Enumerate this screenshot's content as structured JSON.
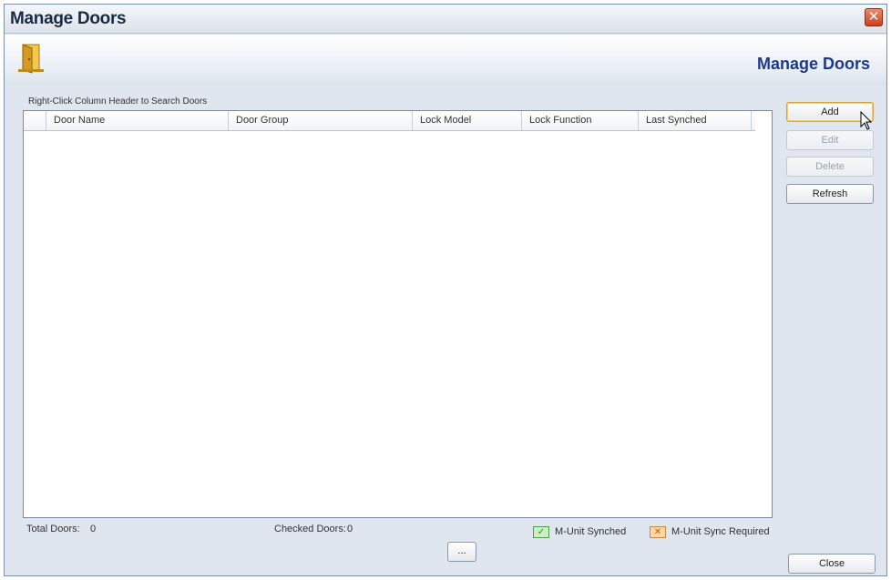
{
  "window": {
    "title": "Manage Doors",
    "close_glyph": "✕"
  },
  "header": {
    "title": "Manage Doors",
    "icon": "door-icon"
  },
  "list": {
    "hint": "Right-Click Column Header to Search Doors",
    "columns": [
      "Door Name",
      "Door Group",
      "Lock Model",
      "Lock Function",
      "Last Synched"
    ]
  },
  "actions": {
    "add": "Add",
    "edit": "Edit",
    "delete": "Delete",
    "refresh": "Refresh"
  },
  "footer": {
    "total_label": "Total Doors:",
    "total_value": "0",
    "checked_label": "Checked Doors:",
    "checked_value": "0",
    "legend_synched": "M-Unit Synched",
    "legend_sync_required": "M-Unit Sync Required",
    "dots": "...",
    "close": "Close"
  },
  "colors": {
    "title_blue": "#1b3a8a",
    "accent_orange": "#d8a33a"
  }
}
